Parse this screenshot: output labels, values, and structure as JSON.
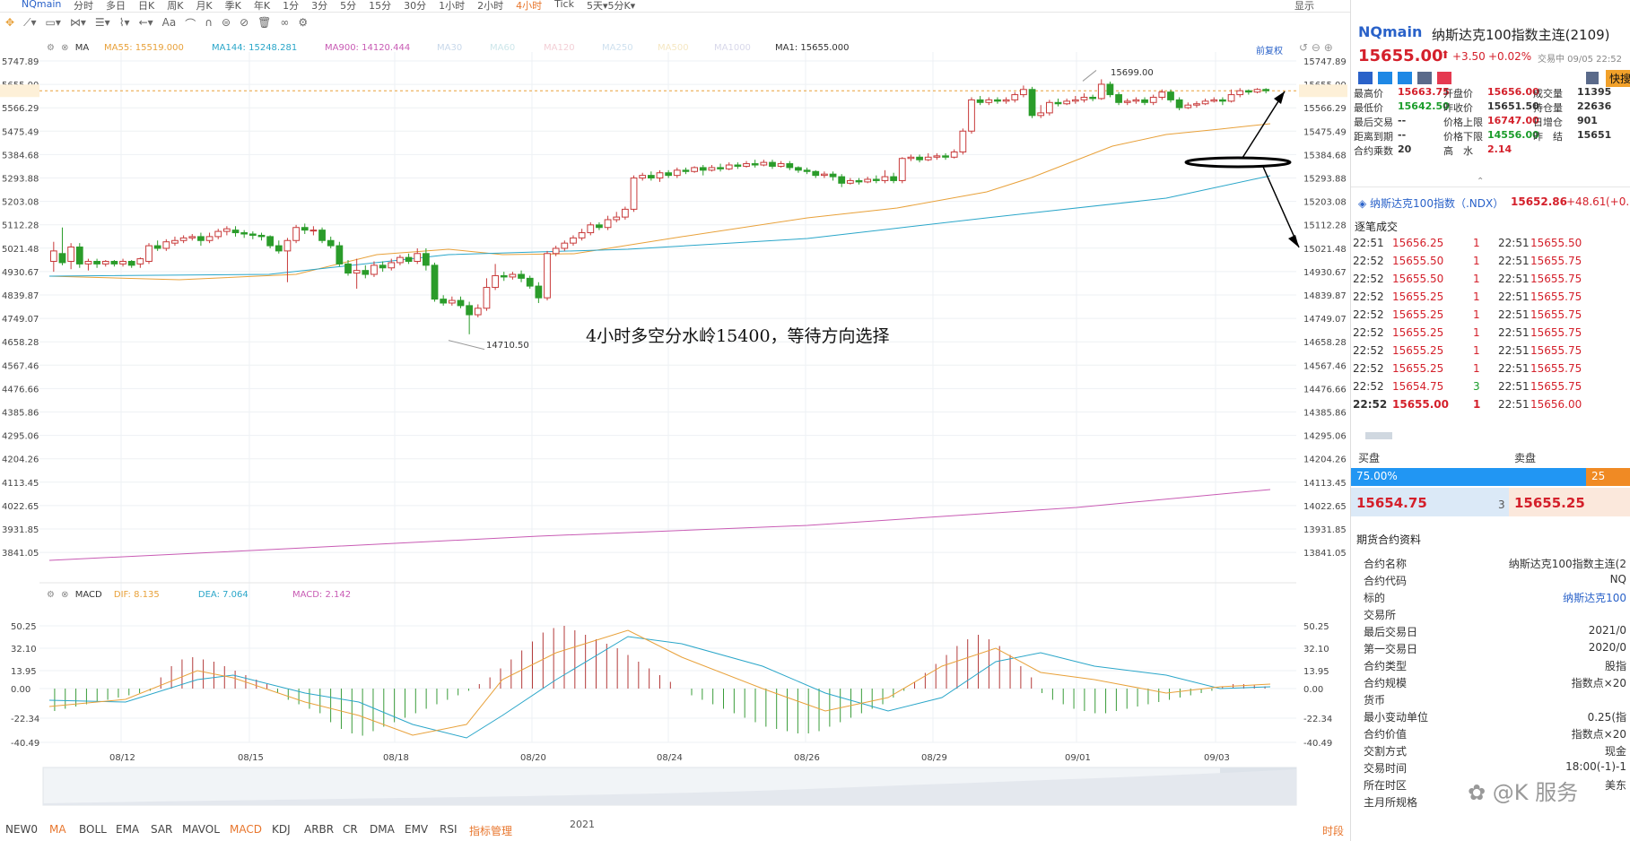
{
  "toolbar": {
    "symbol": "NQmain",
    "timeframes": [
      "分时",
      "多日",
      "日K",
      "周K",
      "月K",
      "季K",
      "年K",
      "1分",
      "3分",
      "5分",
      "15分",
      "30分",
      "1小时",
      "2小时",
      "4小时",
      "Tick",
      "5天▾5分K▾"
    ],
    "active_timeframe": "4小时",
    "right_label": "显示"
  },
  "main_legend": {
    "indicator": "MA",
    "items": [
      {
        "label": "MA55: 15519.000",
        "color": "#e8a13a"
      },
      {
        "label": "MA144: 15248.281",
        "color": "#2aa6c9"
      },
      {
        "label": "MA900: 14120.444",
        "color": "#c85bb4"
      },
      {
        "label": "MA30",
        "color": "#c8d8ea"
      },
      {
        "label": "MA60",
        "color": "#cde6ea"
      },
      {
        "label": "MA120",
        "color": "#f3cfd6"
      },
      {
        "label": "MA250",
        "color": "#cfe1ef"
      },
      {
        "label": "MA500",
        "color": "#f5e7c2"
      },
      {
        "label": "MA1000",
        "color": "#d8d8ea"
      },
      {
        "label": "MA1: 15655.000",
        "color": "#333333"
      }
    ],
    "right_label": "前复权"
  },
  "price_axis": [
    "5747.89",
    "5655.00",
    "5566.29",
    "5475.49",
    "5384.68",
    "5293.88",
    "5203.08",
    "5112.28",
    "5021.48",
    "4930.67",
    "4839.87",
    "4749.07",
    "4658.28",
    "4567.46",
    "4476.66",
    "4385.86",
    "4295.06",
    "4204.26",
    "4113.45",
    "4022.65",
    "3931.85",
    "3841.05"
  ],
  "price_axis_right": [
    "15747.89",
    "15655.00",
    "15566.29",
    "15475.49",
    "15384.68",
    "15293.88",
    "15203.08",
    "15112.28",
    "15021.48",
    "14930.67",
    "14839.87",
    "14749.07",
    "14658.28",
    "14567.46",
    "14476.66",
    "14385.86",
    "14295.06",
    "14204.26",
    "14113.45",
    "14022.65",
    "13931.85",
    "13841.05"
  ],
  "high_label": "15699.00",
  "low_label": "14710.50",
  "annotation": "4小时多空分水岭15400，等待方向选择",
  "macd_legend": {
    "indicator": "MACD",
    "dif": "DIF: 8.135",
    "dea": "DEA: 7.064",
    "macd": "MACD: 2.142"
  },
  "macd_axis": [
    "50.25",
    "32.10",
    "13.95",
    "0.00",
    "-22.34",
    "-40.49"
  ],
  "date_axis": [
    "08/12",
    "08/15",
    "08/18",
    "08/20",
    "08/24",
    "08/26",
    "08/29",
    "09/01",
    "09/03"
  ],
  "navigator_year": "2021",
  "bottom_tabs": [
    "NEW0",
    "MA",
    "BOLL",
    "EMA",
    "SAR",
    "MAVOL",
    "MACD",
    "KDJ",
    "ARBR",
    "CR",
    "DMA",
    "EMV",
    "RSI",
    "指标管理"
  ],
  "bottom_right": "时段",
  "quote": {
    "symbol": "NQmain",
    "name": "纳斯达克100指数主连(2109)",
    "price": "15655.00",
    "change": "+3.50",
    "change_pct": "+0.02%",
    "status": "交易中 09/05 22:52",
    "quick_btn": "快搜",
    "stats": [
      {
        "label": "最高价",
        "value": "15663.75",
        "cls": "red"
      },
      {
        "label": "开盘价",
        "value": "15656.00",
        "cls": "red"
      },
      {
        "label": "成交量",
        "value": "11395",
        "cls": ""
      },
      {
        "label": "最低价",
        "value": "15642.50",
        "cls": "green"
      },
      {
        "label": "昨收价",
        "value": "15651.50",
        "cls": ""
      },
      {
        "label": "持仓量",
        "value": "22636",
        "cls": ""
      },
      {
        "label": "最后交易",
        "value": "--",
        "cls": ""
      },
      {
        "label": "价格上限",
        "value": "16747.00",
        "cls": "red"
      },
      {
        "label": "日增仓",
        "value": "901",
        "cls": ""
      },
      {
        "label": "距离到期",
        "value": "--",
        "cls": ""
      },
      {
        "label": "价格下限",
        "value": "14556.00",
        "cls": "green"
      },
      {
        "label": "昨　结",
        "value": "15651",
        "cls": ""
      },
      {
        "label": "合约乘数",
        "value": "20",
        "cls": ""
      },
      {
        "label": "高　水",
        "value": "2.14",
        "cls": "red"
      }
    ],
    "index_name": "纳斯达克100指数（.NDX）",
    "index_price": "15652.86",
    "index_change": "+48.61",
    "index_pct": "(+0.3"
  },
  "trades_title": "逐笔成交",
  "trades": [
    [
      "22:51",
      "15656.25",
      "1",
      "22:51",
      "15655.50"
    ],
    [
      "22:52",
      "15655.50",
      "1",
      "22:51",
      "15655.75"
    ],
    [
      "22:52",
      "15655.50",
      "1",
      "22:51",
      "15655.75"
    ],
    [
      "22:52",
      "15655.25",
      "1",
      "22:51",
      "15655.75"
    ],
    [
      "22:52",
      "15655.25",
      "1",
      "22:51",
      "15655.75"
    ],
    [
      "22:52",
      "15655.25",
      "1",
      "22:51",
      "15655.75"
    ],
    [
      "22:52",
      "15655.25",
      "1",
      "22:51",
      "15655.75"
    ],
    [
      "22:52",
      "15655.25",
      "1",
      "22:51",
      "15655.75"
    ],
    [
      "22:52",
      "15654.75",
      "3",
      "22:51",
      "15655.75"
    ],
    [
      "22:52",
      "15655.00",
      "1",
      "22:51",
      "15656.00"
    ]
  ],
  "orderbook": {
    "buy_label": "买盘",
    "sell_label": "卖盘",
    "buy_pct": "75.00%",
    "sell_pct": "25",
    "bid": "15654.75",
    "bid_qty": "3",
    "ask": "15655.25"
  },
  "contract_title": "期货合约资料",
  "contract": [
    {
      "label": "合约名称",
      "value": "纳斯达克100指数主连(2"
    },
    {
      "label": "合约代码",
      "value": "NQ"
    },
    {
      "label": "标的",
      "value": "纳斯达克100"
    },
    {
      "label": "交易所",
      "value": ""
    },
    {
      "label": "最后交易日",
      "value": "2021/0"
    },
    {
      "label": "第一交易日",
      "value": "2020/0"
    },
    {
      "label": "合约类型",
      "value": "股指"
    },
    {
      "label": "合约规模",
      "value": "指数点×20"
    },
    {
      "label": "货币",
      "value": ""
    },
    {
      "label": "最小变动单位",
      "value": "0.25(指"
    },
    {
      "label": "合约价值",
      "value": "指数点×20"
    },
    {
      "label": "交割方式",
      "value": "现金"
    },
    {
      "label": "交易时间",
      "value": "18:00(-1)-1"
    },
    {
      "label": "所在时区",
      "value": "美东"
    },
    {
      "label": "主月所规格",
      "value": ""
    }
  ],
  "watermark": "@K 服务",
  "chart_data": {
    "type": "candlestick",
    "price_range": [
      13790,
      15790
    ],
    "high_marker": 15699.0,
    "low_marker": 14710.5,
    "last_price": 15655.0,
    "candles": [
      [
        15000,
        15040,
        14960,
        15075
      ],
      [
        15030,
        14995,
        14985,
        15130
      ],
      [
        15000,
        15055,
        14970,
        15070
      ],
      [
        15055,
        14990,
        14975,
        15070
      ],
      [
        14990,
        15000,
        14965,
        15010
      ],
      [
        15000,
        14990,
        14975,
        15010
      ],
      [
        14990,
        15000,
        14980,
        15005
      ],
      [
        15000,
        14990,
        14980,
        15005
      ],
      [
        14990,
        15000,
        14980,
        15010
      ],
      [
        15000,
        14985,
        14975,
        15005
      ],
      [
        14990,
        15010,
        14975,
        15015
      ],
      [
        15000,
        15060,
        14990,
        15070
      ],
      [
        15060,
        15050,
        15040,
        15080
      ],
      [
        15050,
        15075,
        15040,
        15085
      ],
      [
        15070,
        15080,
        15060,
        15095
      ],
      [
        15080,
        15090,
        15070,
        15100
      ],
      [
        15090,
        15095,
        15080,
        15105
      ],
      [
        15095,
        15080,
        15060,
        15110
      ],
      [
        15080,
        15095,
        15070,
        15110
      ],
      [
        15095,
        15115,
        15085,
        15125
      ],
      [
        15115,
        15125,
        15100,
        15135
      ],
      [
        15120,
        15110,
        15095,
        15135
      ],
      [
        15110,
        15105,
        15090,
        15120
      ],
      [
        15105,
        15100,
        15085,
        15115
      ],
      [
        15100,
        15095,
        15080,
        15110
      ],
      [
        15095,
        15060,
        15050,
        15100
      ],
      [
        15060,
        15040,
        15030,
        15080
      ],
      [
        15040,
        15080,
        14920,
        15090
      ],
      [
        15080,
        15130,
        15070,
        15140
      ],
      [
        15130,
        15120,
        15105,
        15145
      ],
      [
        15120,
        15120,
        15100,
        15135
      ],
      [
        15120,
        15080,
        15070,
        15130
      ],
      [
        15080,
        15060,
        15050,
        15095
      ],
      [
        15060,
        14990,
        14980,
        15075
      ],
      [
        14990,
        14955,
        14945,
        15005
      ],
      [
        14955,
        14965,
        14895,
        15010
      ],
      [
        14965,
        14950,
        14935,
        14985
      ],
      [
        14950,
        14985,
        14940,
        15000
      ],
      [
        14985,
        14975,
        14960,
        15000
      ],
      [
        14975,
        14995,
        14965,
        15010
      ],
      [
        14995,
        15015,
        14985,
        15025
      ],
      [
        15015,
        15000,
        14990,
        15030
      ],
      [
        15000,
        15030,
        14990,
        15050
      ],
      [
        15030,
        14985,
        14965,
        15050
      ],
      [
        14985,
        14855,
        14845,
        14995
      ],
      [
        14855,
        14840,
        14830,
        14870
      ],
      [
        14840,
        14850,
        14830,
        14865
      ],
      [
        14850,
        14830,
        14820,
        14865
      ],
      [
        14830,
        14795,
        14720,
        14845
      ],
      [
        14795,
        14820,
        14785,
        14835
      ],
      [
        14820,
        14900,
        14810,
        14935
      ],
      [
        14900,
        14945,
        14890,
        14990
      ],
      [
        14945,
        14940,
        14925,
        14960
      ],
      [
        14940,
        14950,
        14930,
        14960
      ],
      [
        14950,
        14935,
        14920,
        14965
      ],
      [
        14935,
        14905,
        14895,
        14945
      ],
      [
        14905,
        14860,
        14840,
        14920
      ],
      [
        14860,
        15030,
        14850,
        15040
      ],
      [
        15030,
        15050,
        15020,
        15060
      ],
      [
        15050,
        15070,
        15040,
        15080
      ],
      [
        15070,
        15090,
        15060,
        15100
      ],
      [
        15090,
        15110,
        15080,
        15125
      ],
      [
        15110,
        15140,
        15100,
        15150
      ],
      [
        15140,
        15130,
        15120,
        15150
      ],
      [
        15130,
        15160,
        15120,
        15175
      ],
      [
        15160,
        15170,
        15150,
        15190
      ],
      [
        15170,
        15200,
        15160,
        15210
      ],
      [
        15200,
        15320,
        15190,
        15330
      ],
      [
        15320,
        15330,
        15310,
        15340
      ],
      [
        15330,
        15320,
        15310,
        15345
      ],
      [
        15320,
        15340,
        15305,
        15350
      ],
      [
        15340,
        15330,
        15320,
        15350
      ],
      [
        15330,
        15350,
        15320,
        15360
      ],
      [
        15350,
        15345,
        15335,
        15360
      ],
      [
        15345,
        15360,
        15340,
        15365
      ],
      [
        15360,
        15350,
        15330,
        15370
      ],
      [
        15350,
        15360,
        15345,
        15370
      ],
      [
        15360,
        15355,
        15345,
        15375
      ],
      [
        15355,
        15370,
        15350,
        15380
      ],
      [
        15370,
        15365,
        15355,
        15380
      ],
      [
        15365,
        15375,
        15360,
        15385
      ],
      [
        15375,
        15370,
        15360,
        15390
      ],
      [
        15370,
        15380,
        15365,
        15390
      ],
      [
        15380,
        15365,
        15355,
        15390
      ],
      [
        15365,
        15375,
        15360,
        15385
      ],
      [
        15375,
        15360,
        15350,
        15385
      ],
      [
        15360,
        15350,
        15340,
        15365
      ],
      [
        15350,
        15345,
        15335,
        15360
      ],
      [
        15345,
        15330,
        15320,
        15350
      ],
      [
        15330,
        15335,
        15320,
        15345
      ],
      [
        15335,
        15325,
        15310,
        15345
      ],
      [
        15325,
        15300,
        15285,
        15335
      ],
      [
        15300,
        15310,
        15295,
        15320
      ],
      [
        15310,
        15305,
        15295,
        15320
      ],
      [
        15305,
        15315,
        15300,
        15325
      ],
      [
        15315,
        15310,
        15300,
        15330
      ],
      [
        15310,
        15325,
        15300,
        15350
      ],
      [
        15325,
        15310,
        15300,
        15340
      ],
      [
        15310,
        15395,
        15300,
        15400
      ],
      [
        15395,
        15400,
        15385,
        15410
      ],
      [
        15400,
        15390,
        15380,
        15410
      ],
      [
        15390,
        15400,
        15385,
        15415
      ],
      [
        15400,
        15405,
        15390,
        15415
      ],
      [
        15405,
        15400,
        15390,
        15415
      ],
      [
        15400,
        15420,
        15395,
        15430
      ],
      [
        15420,
        15500,
        15410,
        15510
      ],
      [
        15500,
        15620,
        15490,
        15630
      ],
      [
        15620,
        15610,
        15600,
        15635
      ],
      [
        15610,
        15620,
        15600,
        15630
      ],
      [
        15620,
        15615,
        15605,
        15630
      ],
      [
        15615,
        15620,
        15605,
        15630
      ],
      [
        15620,
        15640,
        15610,
        15650
      ],
      [
        15640,
        15660,
        15630,
        15675
      ],
      [
        15660,
        15560,
        15550,
        15670
      ],
      [
        15560,
        15570,
        15550,
        15600
      ],
      [
        15570,
        15610,
        15560,
        15620
      ],
      [
        15610,
        15605,
        15595,
        15625
      ],
      [
        15605,
        15615,
        15600,
        15625
      ],
      [
        15615,
        15620,
        15605,
        15635
      ],
      [
        15620,
        15630,
        15610,
        15645
      ],
      [
        15630,
        15625,
        15615,
        15640
      ],
      [
        15625,
        15680,
        15620,
        15699
      ],
      [
        15680,
        15640,
        15630,
        15690
      ],
      [
        15640,
        15610,
        15600,
        15650
      ],
      [
        15610,
        15615,
        15600,
        15625
      ],
      [
        15615,
        15620,
        15605,
        15630
      ],
      [
        15620,
        15610,
        15600,
        15630
      ],
      [
        15610,
        15630,
        15600,
        15640
      ],
      [
        15630,
        15650,
        15620,
        15660
      ],
      [
        15650,
        15620,
        15610,
        15660
      ],
      [
        15620,
        15590,
        15580,
        15630
      ],
      [
        15590,
        15600,
        15585,
        15610
      ],
      [
        15600,
        15605,
        15590,
        15615
      ],
      [
        15605,
        15615,
        15600,
        15625
      ],
      [
        15615,
        15620,
        15610,
        15630
      ],
      [
        15620,
        15615,
        15600,
        15630
      ],
      [
        15615,
        15640,
        15610,
        15660
      ],
      [
        15640,
        15655,
        15630,
        15665
      ],
      [
        15655,
        15650,
        15640,
        15660
      ],
      [
        15650,
        15660,
        15645,
        15665
      ],
      [
        15660,
        15655,
        15645,
        15665
      ]
    ]
  }
}
